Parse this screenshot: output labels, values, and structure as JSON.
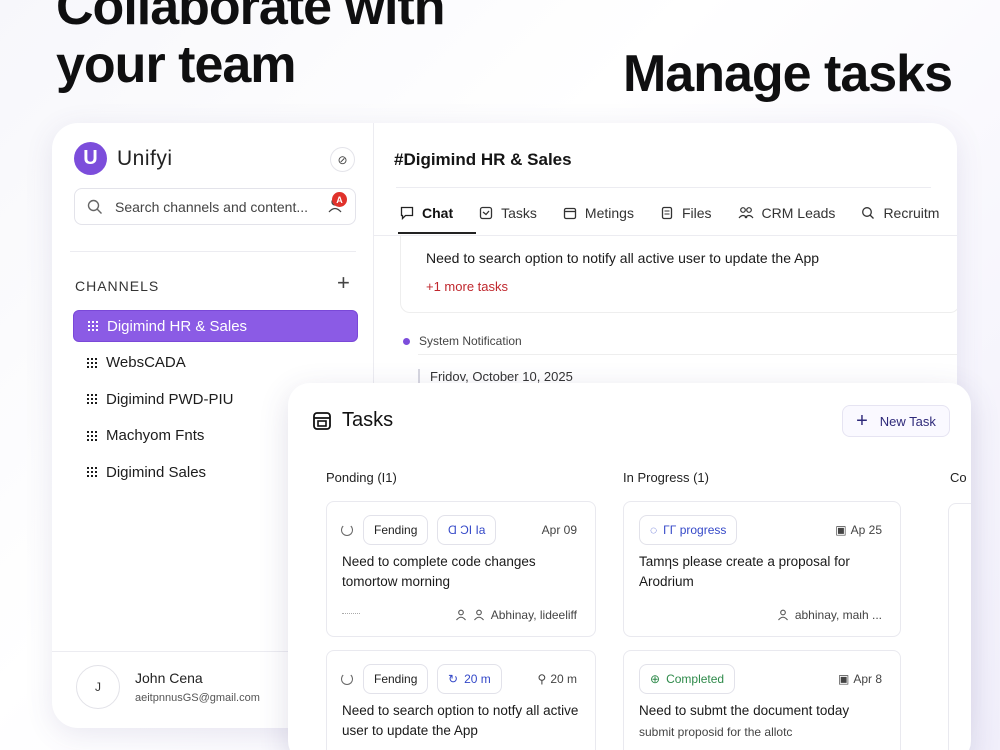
{
  "hero": {
    "left_line1": "Collaborate with",
    "left_line2": "your team",
    "right": "Manage tasks"
  },
  "sidebar": {
    "logo_letter": "U",
    "app_name": "Unifyi",
    "logo_btn": "⊘",
    "search_placeholder": "Search channels and content...",
    "alert_count": "A",
    "channels_title": "CHANNELS",
    "add_channel": "+",
    "channels": [
      {
        "label": "Digimind HR & Sales",
        "active": true
      },
      {
        "label": "WebsCADA"
      },
      {
        "label": "Digimind PWD-PIU"
      },
      {
        "label": "Machyom Fnts"
      },
      {
        "label": "Digimind Sales"
      }
    ],
    "user": {
      "initial": "J",
      "name": "John Cena",
      "email": "aeitpnnusGS@gmail.com"
    }
  },
  "main": {
    "channel_title": "#Digimind HR & Sales",
    "tabs": [
      {
        "label": "Chat",
        "icon": "chat-icon"
      },
      {
        "label": "Tasks",
        "icon": "checkbox-icon"
      },
      {
        "label": "Metings",
        "icon": "calendar-icon"
      },
      {
        "label": "Files",
        "icon": "file-icon"
      },
      {
        "label": "CRM Leads",
        "icon": "people-icon"
      },
      {
        "label": "Recruitm",
        "icon": "search-icon"
      }
    ],
    "message": "Need to search option to notify all active user to update the App",
    "more_tasks": "+1 more tasks",
    "system_label": "System Notification",
    "system_msg": "Fridov, October 10, 2025"
  },
  "tasks": {
    "title": "Tasks",
    "new_task": "New Task",
    "columns": [
      {
        "label": "Ponding (I1)"
      },
      {
        "label": "In Progress (1)"
      },
      {
        "label": "Co"
      }
    ],
    "cards": [
      {
        "status": "Fending",
        "tag": "Ɑ ϽΙ Ιa",
        "date": "Apr 09",
        "title": "Need to complete code changes tomortow morning",
        "people": "Abhinay, lideeliff",
        "dots": "......"
      },
      {
        "status": "ΓΓ progress",
        "date": "Ap 25",
        "title": "Tamηs please create a proposal for Arodrium",
        "people": "abhinay, maιh ..."
      },
      {
        "status": "Fending",
        "tag": "20 m",
        "date": "20 m",
        "title": "Need to search option to notfy all active user to update the App"
      },
      {
        "status": "Completed",
        "date": "Apr 8",
        "title": "Need to submt the document today",
        "sub": "submit proposid for the allotc"
      }
    ]
  },
  "colors": {
    "accent": "#8b5be5",
    "alert": "#e0322b",
    "link_red": "#c0272d"
  }
}
